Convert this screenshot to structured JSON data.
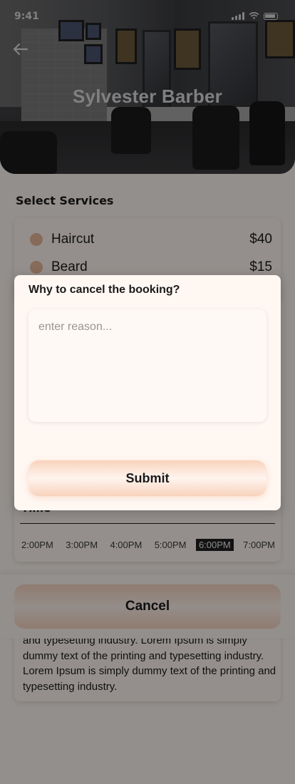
{
  "status_bar": {
    "time": "9:41",
    "signal_icon": "signal-icon",
    "wifi_icon": "wifi-icon",
    "battery_icon": "battery-icon"
  },
  "header": {
    "title": "Sylvester Barber",
    "back_icon": "arrow-left-icon"
  },
  "services": {
    "heading": "Select Services",
    "items": [
      {
        "name": "Haircut",
        "price": "$40"
      },
      {
        "name": "Beard",
        "price": "$15"
      }
    ]
  },
  "time": {
    "label": "Time",
    "slots": [
      "2:00PM",
      "3:00PM",
      "4:00PM",
      "5:00PM",
      "6:00PM",
      "7:00PM"
    ],
    "selected": "6:00PM"
  },
  "about": {
    "text": "and typesetting industry. Lorem Ipsum is simply dummy text of the printing and typesetting industry. Lorem Ipsum is simply dummy text of the printing and typesetting industry."
  },
  "actions": {
    "cancel_label": "Cancel"
  },
  "modal": {
    "title": "Why to cancel the booking?",
    "reason_placeholder": "enter reason...",
    "reason_value": "",
    "submit_label": "Submit"
  },
  "colors": {
    "accent": "#f8d3bd",
    "accent_light": "#fff4ee",
    "card_bg": "#fff7f2",
    "dot": "#e8b99b"
  }
}
